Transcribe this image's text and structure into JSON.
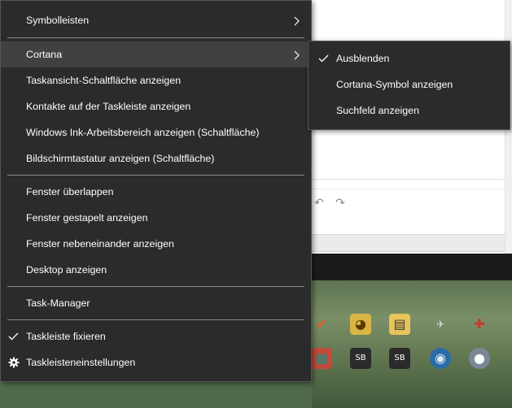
{
  "colors": {
    "menu_bg": "#2b2b2b",
    "menu_hover": "#414141",
    "menu_text": "#ffffff",
    "separator": "#8a8a8a"
  },
  "context_menu": {
    "items": [
      {
        "label": "Symbolleisten",
        "has_submenu": true
      },
      {
        "label": "Cortana",
        "has_submenu": true,
        "highlighted": true
      },
      {
        "label": "Taskansicht-Schaltfläche anzeigen"
      },
      {
        "label": "Kontakte auf der Taskleiste anzeigen"
      },
      {
        "label": "Windows Ink-Arbeitsbereich anzeigen (Schaltfläche)"
      },
      {
        "label": "Bildschirmtastatur anzeigen (Schaltfläche)"
      },
      {
        "label": "Fenster überlappen"
      },
      {
        "label": "Fenster gestapelt anzeigen"
      },
      {
        "label": "Fenster nebeneinander anzeigen"
      },
      {
        "label": "Desktop anzeigen"
      },
      {
        "label": "Task-Manager"
      },
      {
        "label": "Taskleiste fixieren",
        "checked": true
      },
      {
        "label": "Taskleisteneinstellungen",
        "icon": "gear-icon"
      }
    ]
  },
  "cortana_submenu": {
    "items": [
      {
        "label": "Ausblenden",
        "checked": true
      },
      {
        "label": "Cortana-Symbol anzeigen"
      },
      {
        "label": "Suchfeld anzeigen"
      }
    ]
  },
  "background": {
    "toolbar_icons": [
      "undo-icon",
      "redo-icon"
    ],
    "tray_icons": [
      "checkmark-app-icon",
      "bird-app-icon",
      "folder-app-icon",
      "unknown-app-icon",
      "browser-app-icon",
      "game-app-icon",
      "speaker-sb-icon",
      "speaker-sb-icon",
      "disc-app-icon",
      "orb-app-icon"
    ]
  }
}
